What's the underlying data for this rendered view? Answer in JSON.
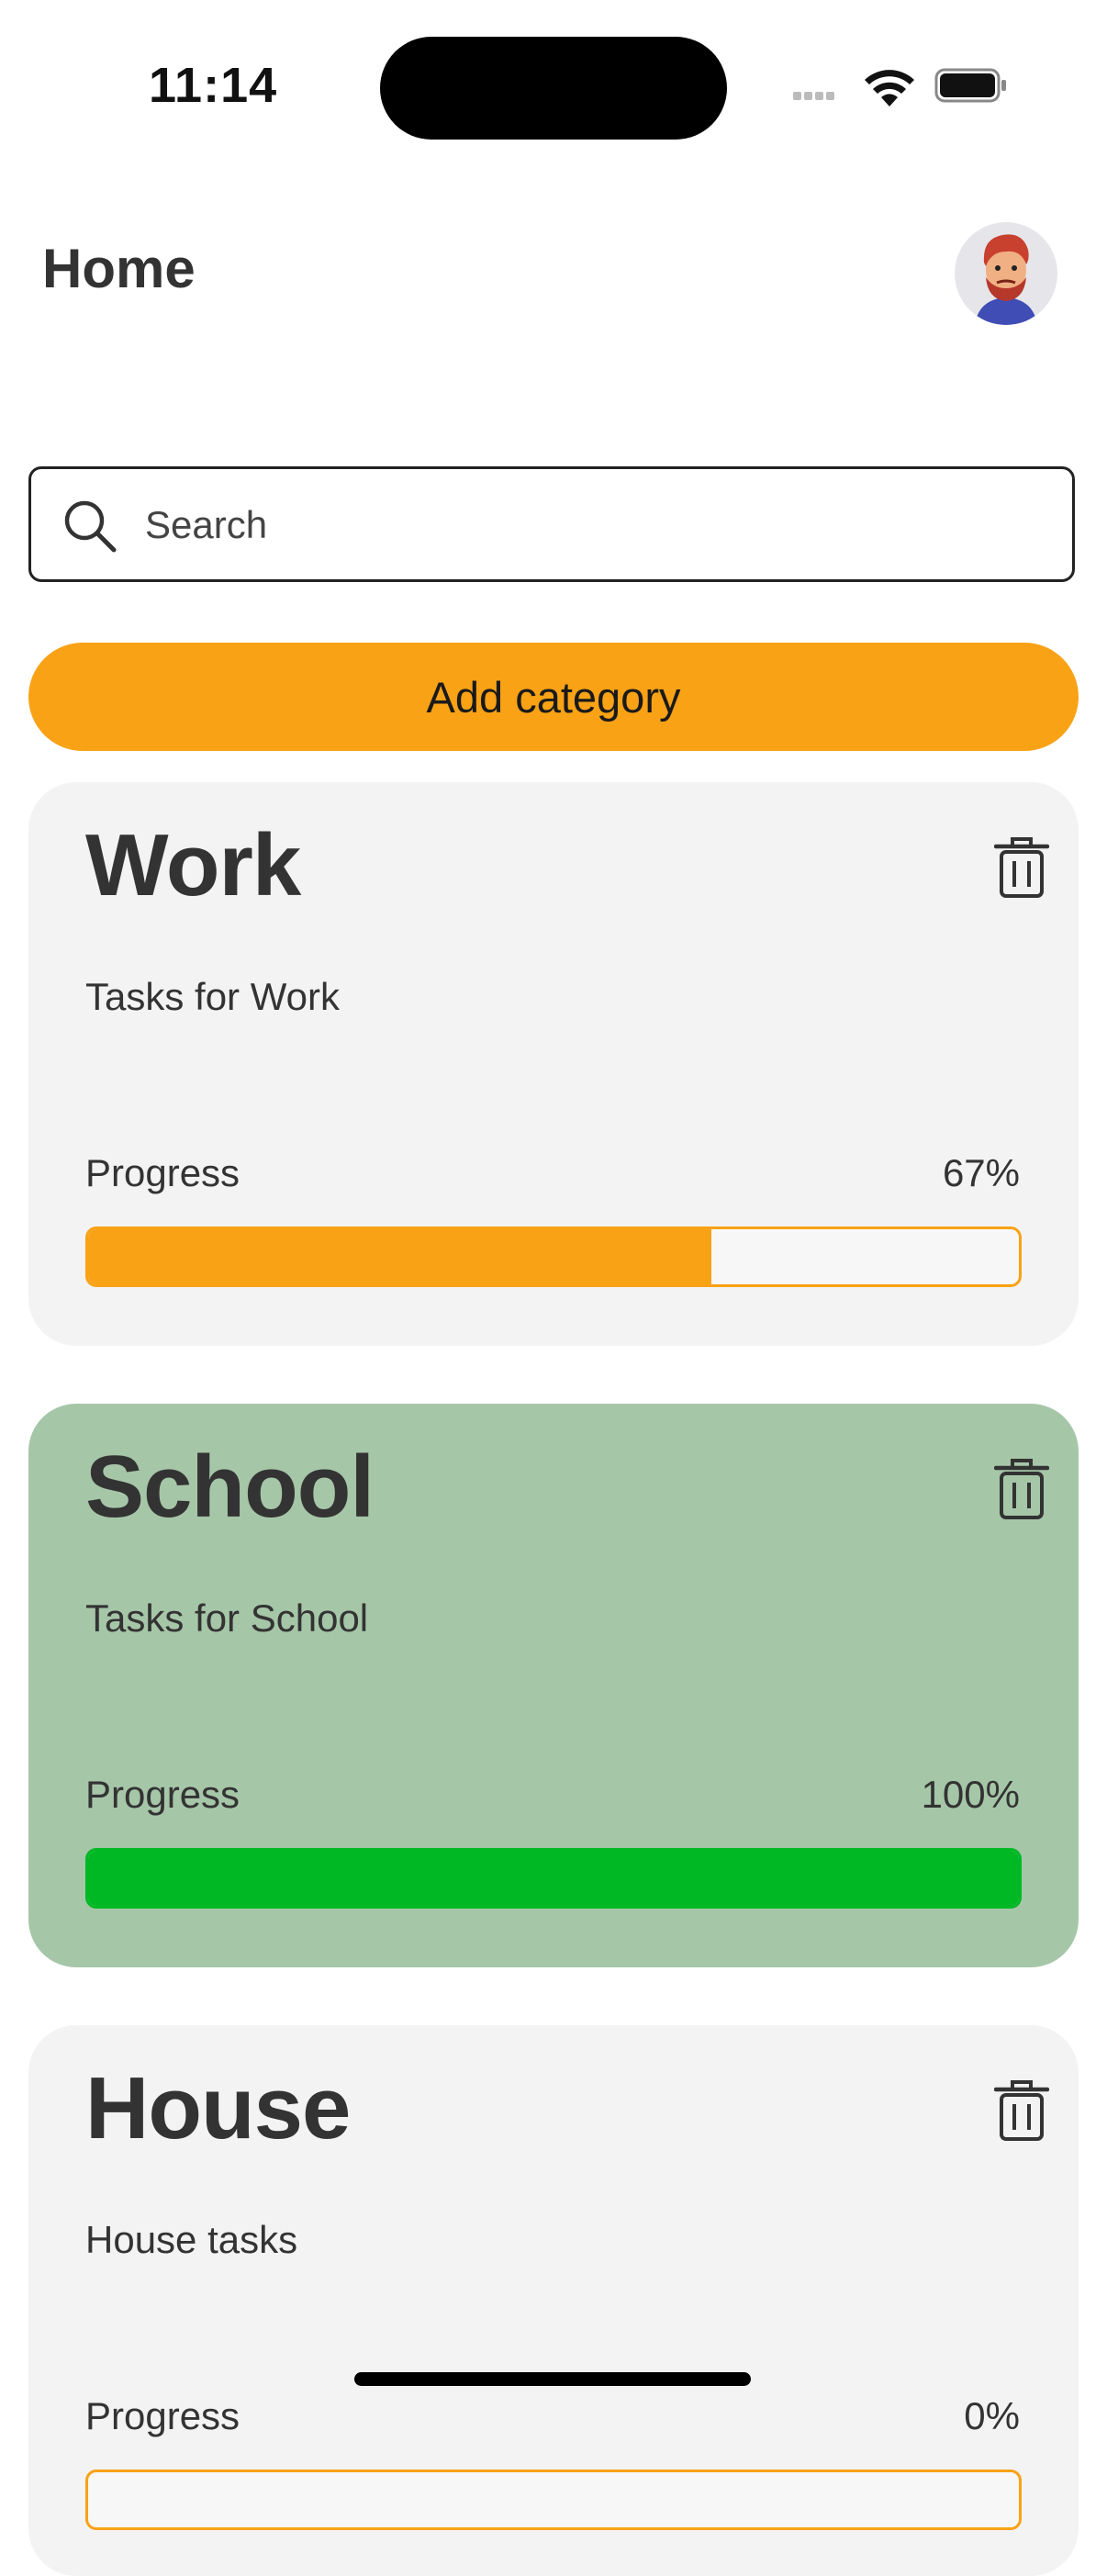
{
  "status_bar": {
    "time": "11:14"
  },
  "header": {
    "title": "Home"
  },
  "search": {
    "placeholder": "Search",
    "value": ""
  },
  "actions": {
    "add_category": "Add category"
  },
  "colors": {
    "accent": "#f9a216",
    "complete": "#00b824",
    "complete_card": "#a6c6a8",
    "card": "#f3f3f3"
  },
  "categories": [
    {
      "title": "Work",
      "description": "Tasks for Work",
      "progress_label": "Progress",
      "progress_text": "67%",
      "progress": 0.67
    },
    {
      "title": "School",
      "description": "Tasks for School",
      "progress_label": "Progress",
      "progress_text": "100%",
      "progress": 1.0
    },
    {
      "title": "House",
      "description": "House tasks",
      "progress_label": "Progress",
      "progress_text": "0%",
      "progress": 0.0
    }
  ],
  "icons": {
    "search": "search-icon",
    "delete": "trash-icon",
    "avatar": "avatar-icon"
  }
}
